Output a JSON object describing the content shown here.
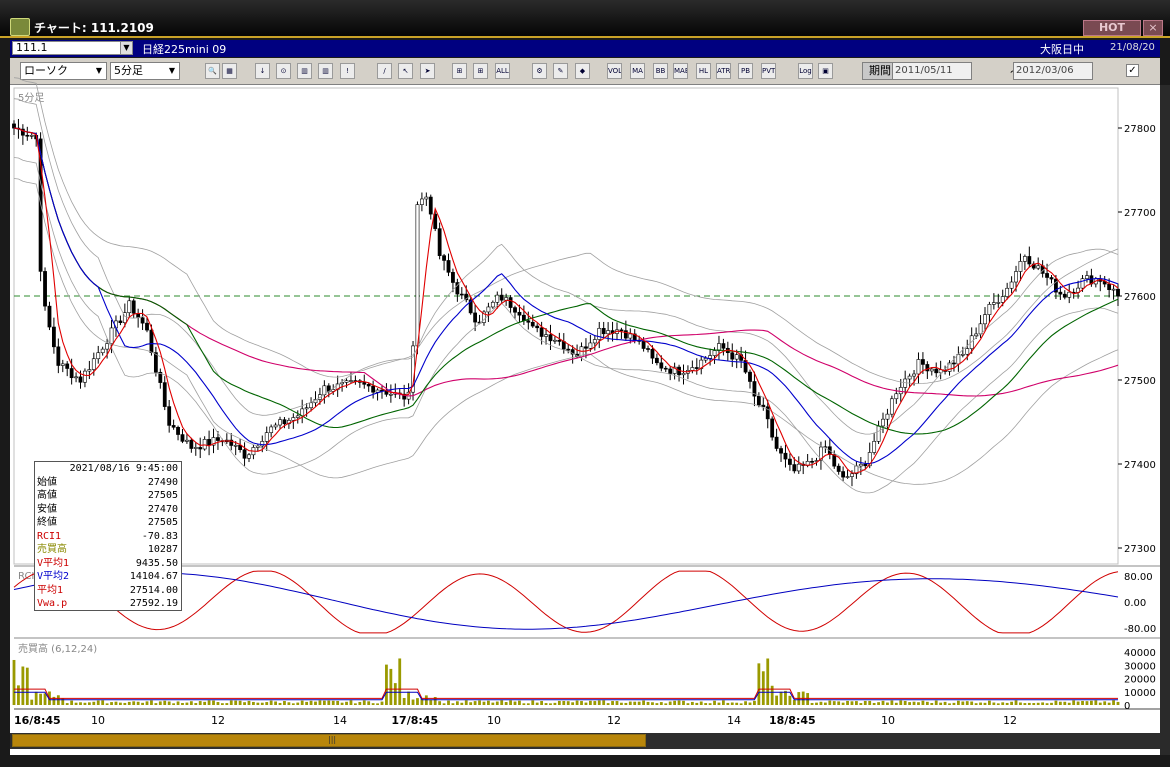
{
  "window": {
    "title": "チャート: 111.2109",
    "hot_label": "HOT",
    "close_label": "×"
  },
  "infobar": {
    "code": "111.1",
    "instrument": "日経225mini 09",
    "market": "大阪日中",
    "date": "21/08/20"
  },
  "toolbar": {
    "chart_type": "ローソク",
    "interval": "5分足",
    "period_label": "期間",
    "date_from": "2011/05/11",
    "tilde": "〜",
    "date_to": "2012/03/06",
    "buttons": [
      {
        "name": "zoom-button",
        "glyph": "🔍"
      },
      {
        "name": "bars-button",
        "glyph": "▦"
      },
      {
        "name": "down-arrow-button",
        "glyph": "↓"
      },
      {
        "name": "find-button",
        "glyph": "⊙"
      },
      {
        "name": "period-button",
        "glyph": "▥"
      },
      {
        "name": "overlay-button",
        "glyph": "▥"
      },
      {
        "name": "alert-button",
        "glyph": "!"
      },
      {
        "name": "draw-line-button",
        "glyph": "/"
      },
      {
        "name": "cursor-button",
        "glyph": "↖"
      },
      {
        "name": "arrow-button",
        "glyph": "➤"
      },
      {
        "name": "candle-a-button",
        "glyph": "⊞"
      },
      {
        "name": "candle-b-button",
        "glyph": "⊞"
      },
      {
        "name": "all-button",
        "glyph": "ALL"
      },
      {
        "name": "tools-button",
        "glyph": "⚙"
      },
      {
        "name": "pen-button",
        "glyph": "✎"
      },
      {
        "name": "color-button",
        "glyph": "◆"
      },
      {
        "name": "vol-button",
        "glyph": "VOL"
      },
      {
        "name": "ma-button",
        "glyph": "MA"
      },
      {
        "name": "bb-button",
        "glyph": "BB"
      },
      {
        "name": "mae-button",
        "glyph": "MAE"
      },
      {
        "name": "hl-button",
        "glyph": "HL"
      },
      {
        "name": "atr-button",
        "glyph": "ATR"
      },
      {
        "name": "pb-button",
        "glyph": "PB"
      },
      {
        "name": "pvt-button",
        "glyph": "PVT"
      },
      {
        "name": "log-button",
        "glyph": "Log"
      },
      {
        "name": "chart-button",
        "glyph": "▣"
      }
    ]
  },
  "main_panel": {
    "label": "5分足",
    "price_ticks": [
      "27800",
      "27700",
      "27600",
      "27500",
      "27400",
      "27300"
    ],
    "dashed_level": 27600
  },
  "rci_panel": {
    "label": "RCI",
    "ticks": [
      "80.00",
      "0.00",
      "-80.00"
    ]
  },
  "volume_panel": {
    "label": "売買高 (6,12,24)",
    "ticks": [
      "40000",
      "30000",
      "20000",
      "10000",
      "0"
    ]
  },
  "x_axis": {
    "labels": [
      "16/8:45",
      "10",
      "12",
      "14",
      "17/8:45",
      "10",
      "12",
      "14",
      "18/8:45",
      "10",
      "12"
    ]
  },
  "data_tip": {
    "datetime": "2021/08/16 9:45:00",
    "rows": [
      {
        "label": "始値",
        "value": "27490",
        "color": "#000000"
      },
      {
        "label": "高値",
        "value": "27505",
        "color": "#000000"
      },
      {
        "label": "安値",
        "value": "27470",
        "color": "#000000"
      },
      {
        "label": "終値",
        "value": "27505",
        "color": "#000000"
      },
      {
        "label": "RCI1",
        "value": "-70.83",
        "color": "#cc0000"
      },
      {
        "label": "売買高",
        "value": "10287",
        "color": "#8a8a00"
      },
      {
        "label": "V平均1",
        "value": "9435.50",
        "color": "#cc0000"
      },
      {
        "label": "V平均2",
        "value": "14104.67",
        "color": "#0000cc"
      },
      {
        "label": "平均1",
        "value": "27514.00",
        "color": "#cc0000"
      },
      {
        "label": "Vwa.p",
        "value": "27592.19",
        "color": "#cc0000"
      }
    ]
  },
  "colors": {
    "ma_short": "#e00000",
    "ma_mid": "#0000cc",
    "ma_long": "#006400",
    "vwap": "#d0006a",
    "band": "#a0a0a0",
    "volume": "#9a9a00",
    "dashed": "#2e8b2e"
  }
}
